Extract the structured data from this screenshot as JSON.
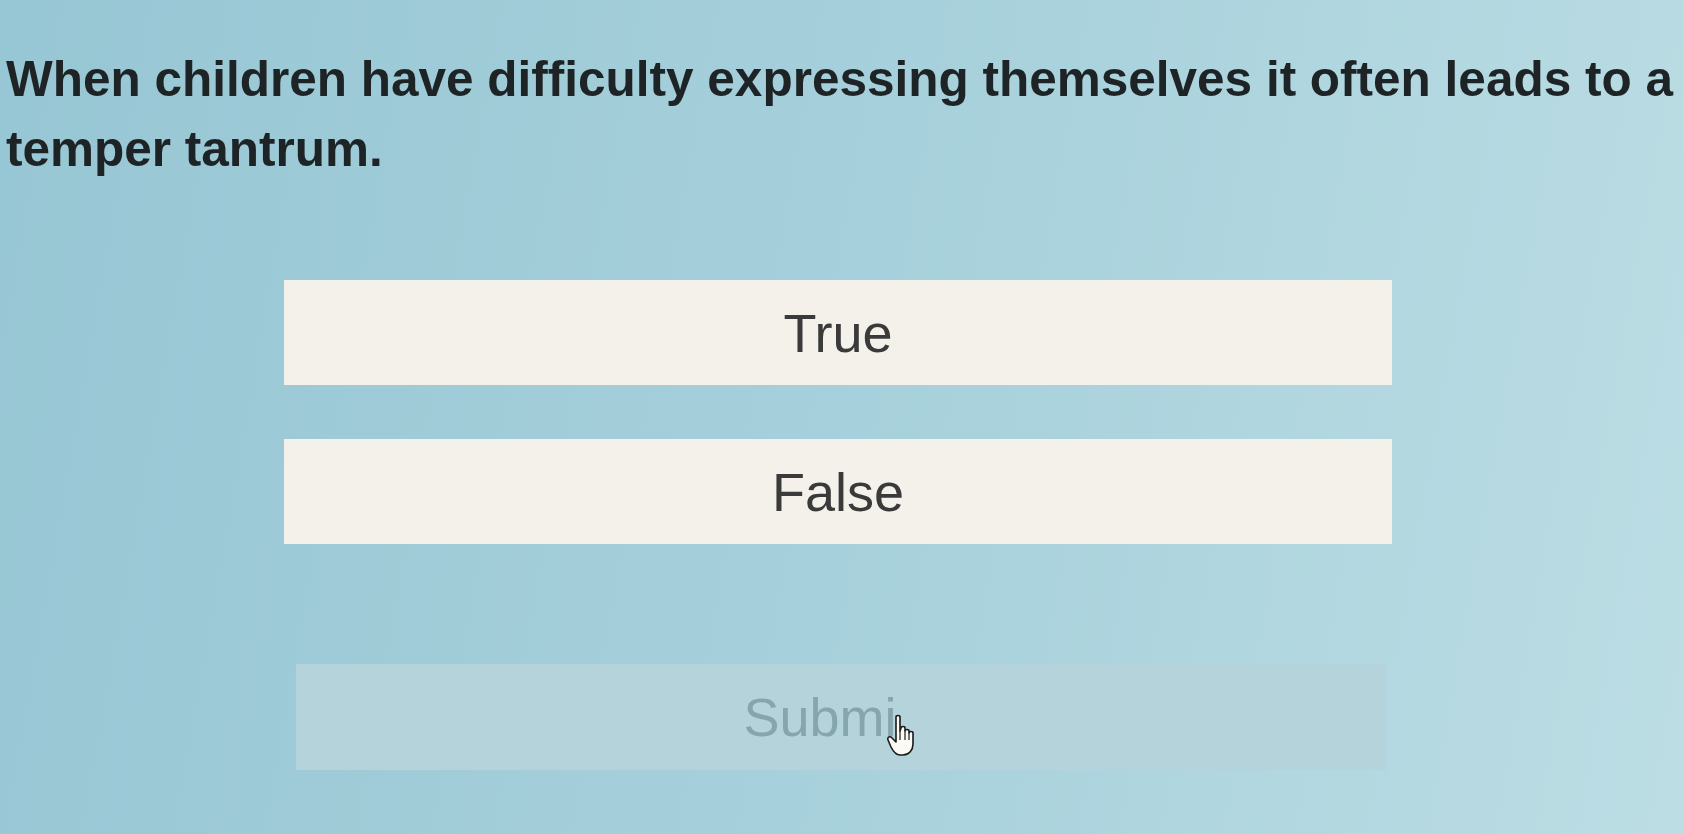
{
  "question": {
    "text": "When children have difficulty expressing themselves it often leads to a temper tantrum."
  },
  "options": [
    {
      "label": "True",
      "selected": false
    },
    {
      "label": "False",
      "selected": false
    }
  ],
  "submit_button": {
    "label": "Submi",
    "disabled": true
  }
}
